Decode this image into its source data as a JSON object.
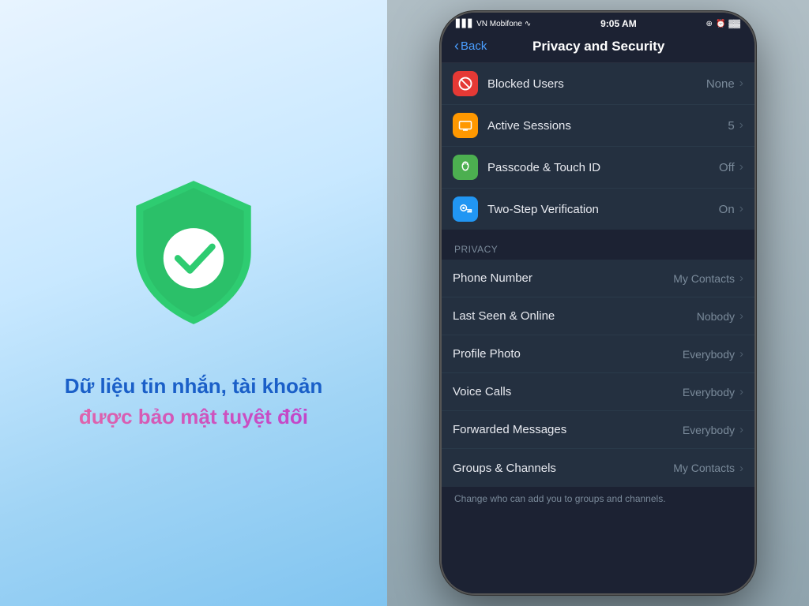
{
  "left": {
    "hero_line1": "Dữ liệu tin nhắn, tài khoản",
    "hero_line2": "được bảo mật tuyệt đối"
  },
  "phone": {
    "status_bar": {
      "carrier": "VN Mobifone",
      "signal_icon": "●●●",
      "wifi_icon": "wifi",
      "time": "9:05 AM",
      "icons_right": "⊕ ⏰ 🔋"
    },
    "nav": {
      "back_label": "Back",
      "title": "Privacy and Security"
    },
    "security_items": [
      {
        "icon_char": "🚫",
        "icon_class": "icon-red",
        "label": "Blocked Users",
        "value": "None"
      },
      {
        "icon_char": "💻",
        "icon_class": "icon-orange",
        "label": "Active Sessions",
        "value": "5"
      },
      {
        "icon_char": "👆",
        "icon_class": "icon-green-fp",
        "label": "Passcode & Touch ID",
        "value": "Off"
      },
      {
        "icon_char": "🔑",
        "icon_class": "icon-blue-key",
        "label": "Two-Step Verification",
        "value": "On"
      }
    ],
    "privacy_section_header": "PRIVACY",
    "privacy_items": [
      {
        "label": "Phone Number",
        "value": "My Contacts"
      },
      {
        "label": "Last Seen & Online",
        "value": "Nobody"
      },
      {
        "label": "Profile Photo",
        "value": "Everybody"
      },
      {
        "label": "Voice Calls",
        "value": "Everybody"
      },
      {
        "label": "Forwarded Messages",
        "value": "Everybody"
      },
      {
        "label": "Groups & Channels",
        "value": "My Contacts"
      }
    ],
    "privacy_footer": "Change who can add you to groups and channels."
  }
}
